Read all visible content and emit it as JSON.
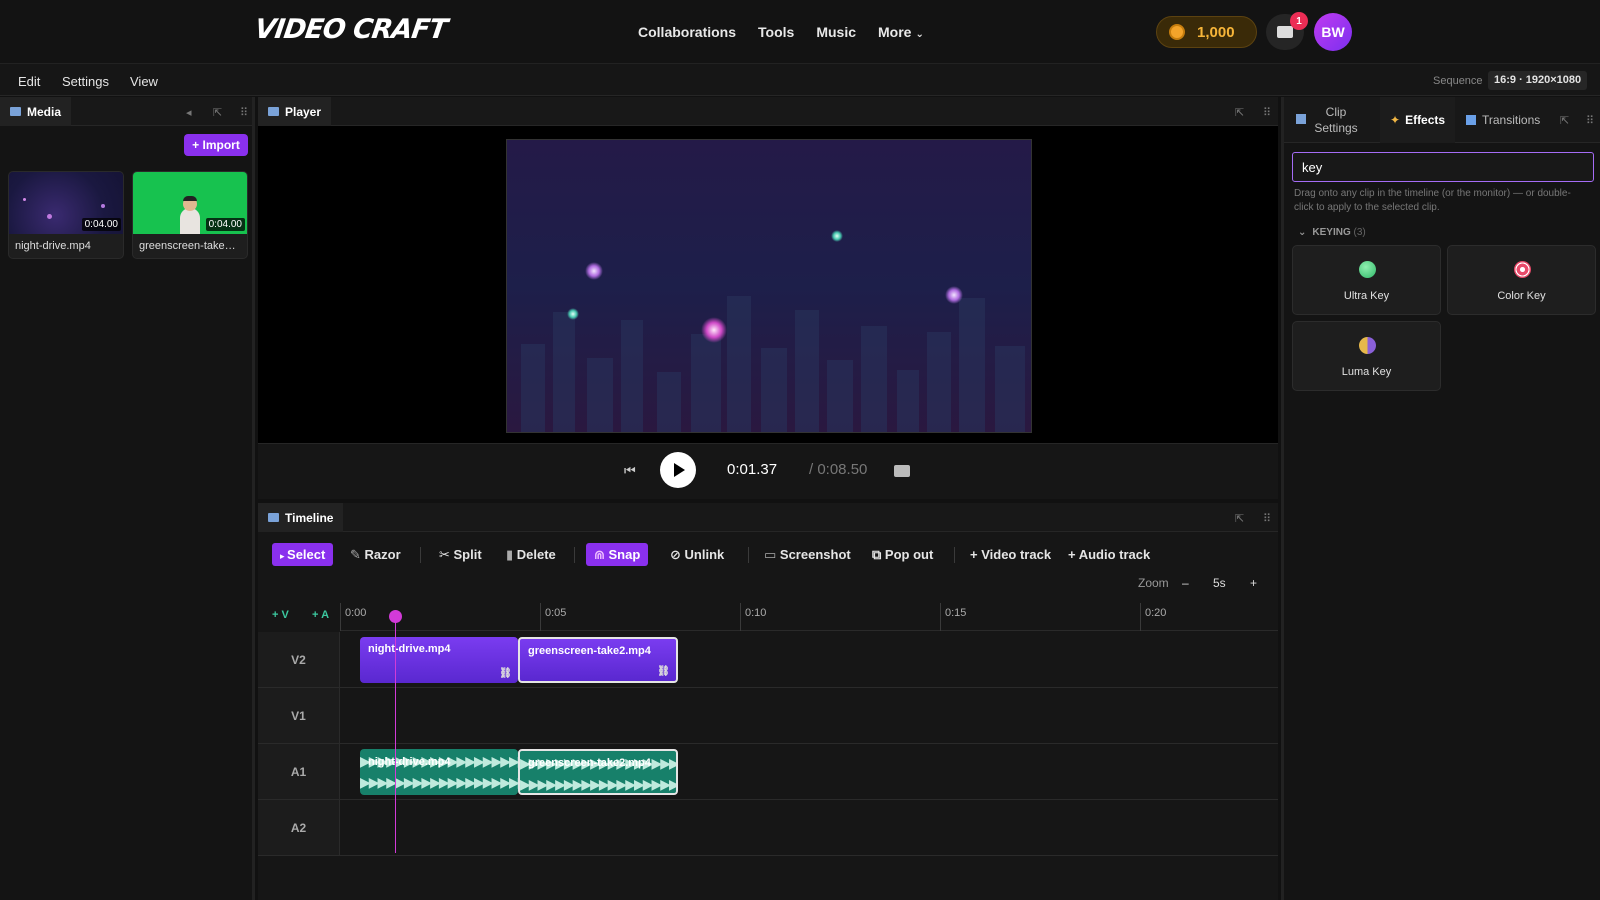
{
  "app": {
    "logo": "VIDEO CRAFT"
  },
  "nav": {
    "items": [
      "Collaborations",
      "Tools",
      "Music",
      "More"
    ],
    "more_chevron": "chevron-down-icon"
  },
  "header": {
    "coins": "1,000",
    "notifications": "1",
    "avatar_initials": "BW"
  },
  "menu": {
    "items": [
      "Edit",
      "Settings",
      "View"
    ],
    "sequence_label": "Sequence",
    "sequence_value": "16:9 · 1920×1080"
  },
  "media": {
    "tab": "Media",
    "import_label": "+ Import",
    "items": [
      {
        "name": "night-drive.mp4",
        "duration": "0:04.00"
      },
      {
        "name": "greenscreen-take…",
        "duration": "0:04.00"
      }
    ]
  },
  "player": {
    "tab": "Player",
    "current_time": "0:01.37",
    "total_time": "/ 0:08.50"
  },
  "timeline": {
    "tab": "Timeline",
    "tools": [
      "Select",
      "Razor",
      "Split",
      "Delete",
      "Snap",
      "Unlink",
      "Screenshot",
      "Pop out",
      "+ Video track",
      "+ Audio track"
    ],
    "zoom_label": "Zoom",
    "zoom_value": "5s",
    "zoom_minus": "–",
    "zoom_plus": "+",
    "add_video": "+ V",
    "add_audio": "+ A",
    "ruler": [
      "0:00",
      "0:05",
      "0:10",
      "0:15",
      "0:20"
    ],
    "tracks": [
      "V2",
      "V1",
      "A1",
      "A2"
    ],
    "clips": {
      "v2a": "night-drive.mp4",
      "v2b": "greenscreen-take2.mp4",
      "a1a": "night-drive.mp4",
      "a1b": "greenscreen-take2.mp4"
    }
  },
  "right_panel": {
    "tabs": [
      "Clip Settings",
      "Effects",
      "Transitions"
    ],
    "search_value": "key",
    "hint": "Drag onto any clip in the timeline (or the monitor) — or double-click to apply to the selected clip.",
    "group_label": "KEYING",
    "group_count": "(3)",
    "effects": [
      {
        "name": "Ultra Key",
        "icon": "green-circle-icon",
        "color": "#3fce7a"
      },
      {
        "name": "Color Key",
        "icon": "target-icon",
        "color": "#e84a6a"
      },
      {
        "name": "Luma Key",
        "icon": "half-circle-icon",
        "color": "#e6b84a"
      }
    ]
  },
  "colors": {
    "accent": "#8a30ee",
    "audio_clip": "#17806a",
    "playhead": "#d23ad8"
  }
}
